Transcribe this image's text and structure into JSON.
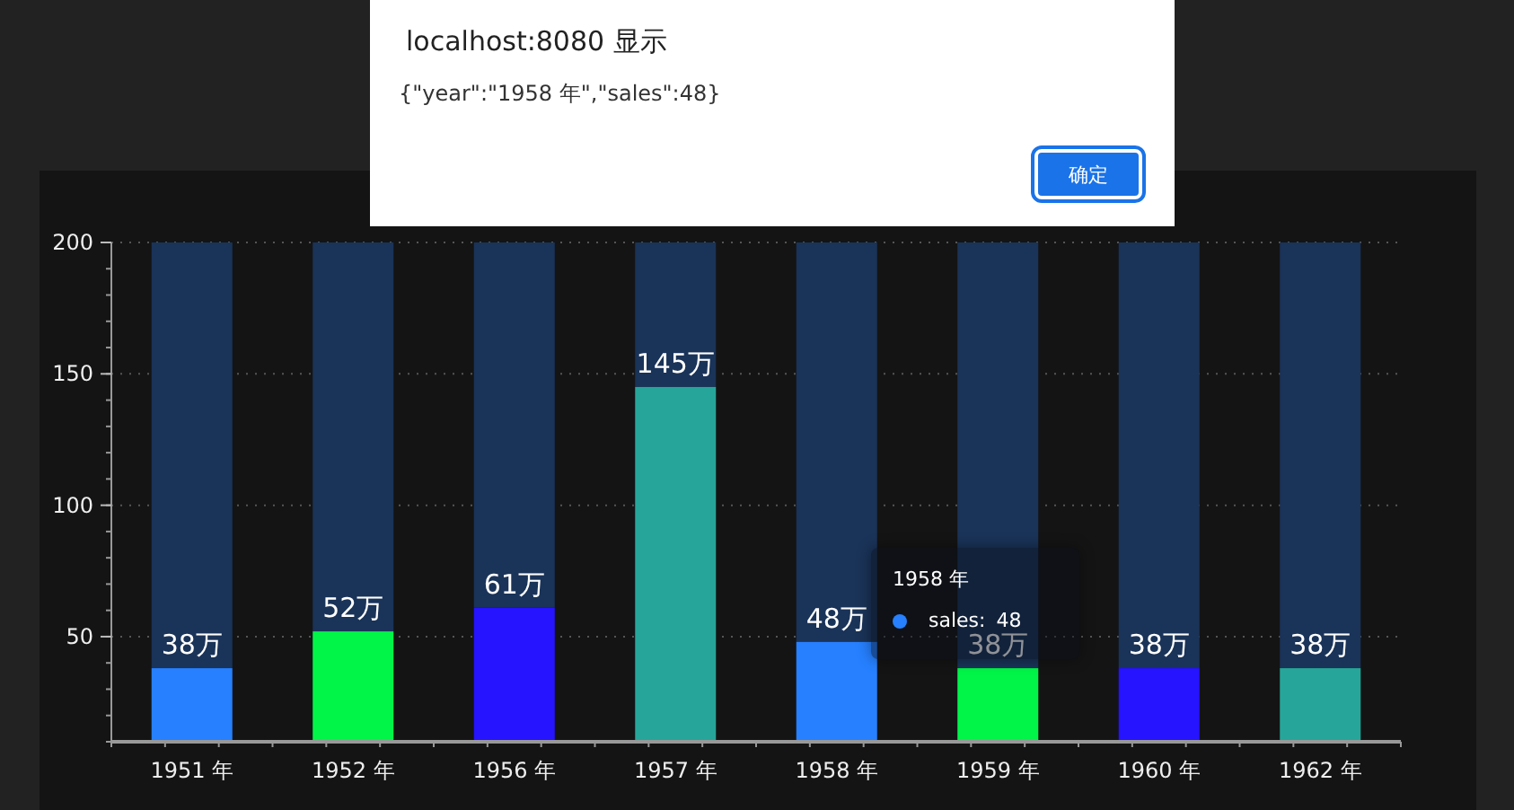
{
  "dialog": {
    "title": "localhost:8080 显示",
    "message": "{\"year\":\"1958 年\",\"sales\":48}",
    "button": "确定"
  },
  "chart": {
    "chart_data": {
      "type": "bar",
      "categories": [
        "1951 年",
        "1952 年",
        "1956 年",
        "1957 年",
        "1958 年",
        "1959 年",
        "1960 年",
        "1962 年"
      ],
      "series": [
        {
          "name": "sales",
          "colors": [
            "#2680ff",
            "#00f548",
            "#2613ff",
            "#26a69a",
            "#2680ff",
            "#00f548",
            "#2613ff",
            "#26a69a"
          ],
          "values": [
            38,
            52,
            61,
            145,
            48,
            38,
            38,
            38
          ]
        },
        {
          "color": "#1a3358",
          "values": [
            162,
            148,
            139,
            55,
            152,
            162,
            162,
            162
          ]
        }
      ],
      "stacked": true,
      "ylim": [
        10,
        200
      ],
      "yticks": [
        50,
        100,
        150,
        200
      ],
      "grid": true,
      "value_labels": [
        "38万",
        "52万",
        "61万",
        "145万",
        "48万",
        "38万",
        "38万",
        "38万"
      ]
    }
  },
  "tooltip": {
    "title": "1958 年",
    "separator": ":",
    "value": "48",
    "color": "#2680ff"
  }
}
